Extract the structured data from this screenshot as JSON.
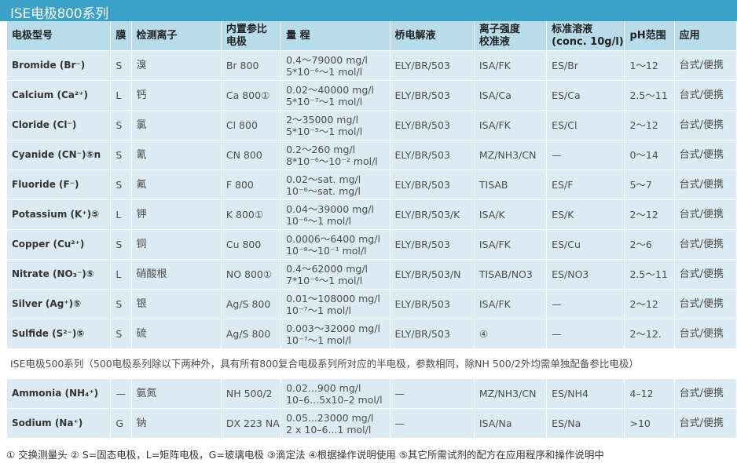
{
  "title": "ISE电极800系列",
  "colors": {
    "title_bg": "#3aa2c8",
    "header_bg": "#b9dceb",
    "row_bg": "#dcebf3"
  },
  "headers": [
    "电极型号",
    "膜",
    "检测离子",
    "内置参比\n电极",
    "量 程",
    "桥电解液",
    "离子强度\n校准液",
    "标准溶液\n(conc. 10g/l)",
    "pH范围",
    "应用"
  ],
  "rows": [
    [
      "Bromide (Br⁻)",
      "S",
      "溴",
      "Br 800",
      "0.4～79000 mg/l",
      "5*10⁻⁶～1 mol/l",
      "ELY/BR/503",
      "ISA/FK",
      "ES/Br",
      "1～12",
      "台式/便携"
    ],
    [
      "Calcium (Ca²⁺)",
      "L",
      "钙",
      "Ca 800①",
      "0.02～40000 mg/l",
      "5*10⁻⁷～1 mol/l",
      "ELY/BR/503",
      "ISA/Ca",
      "ES/Ca",
      "2.5～11",
      "台式/便携"
    ],
    [
      "Cloride (Cl⁻)",
      "S",
      "氯",
      "Cl 800",
      "2～35000 mg/l",
      "5*10⁻⁵～1 mol/l",
      "ELY/BR/503",
      "ISA/FK",
      "ES/Cl",
      "2～12",
      "台式/便携"
    ],
    [
      "Cyanide (CN⁻)⑤n",
      "S",
      "氰",
      "CN 800",
      "0.2～260 mg/l",
      "8*10⁻⁶～10⁻² mol/l",
      "ELY/BR/503",
      "MZ/NH3/CN",
      "—",
      "0～14",
      "台式/便携"
    ],
    [
      "Fluoride (F⁻)",
      "S",
      "氟",
      "F 800",
      "0.02～sat. mg/l",
      "10⁻⁶～sat. mg/l",
      "ELY/BR/503",
      "TISAB",
      "ES/F",
      "5～7",
      "台式/便携"
    ],
    [
      "Potassium (K⁺)⑤",
      "L",
      "钾",
      "K 800①",
      "0.04～39000 mg/l",
      "10⁻⁶～1 mol/l",
      "ELY/BR/503/K",
      "ISA/K",
      "ES/K",
      "2～12",
      "台式/便携"
    ],
    [
      "Copper (Cu²⁺)",
      "S",
      "铜",
      "Cu 800",
      "0.0006～6400 mg/l",
      "10⁻⁸～10⁻¹ mol/l",
      "ELY/BR/503",
      "ISA/FK",
      "ES/Cu",
      "2～6",
      "台式/便携"
    ],
    [
      "Nitrate (NO₃⁻)⑤",
      "L",
      "硝酸根",
      "NO 800①",
      "0.4～62000 mg/l",
      "7*10⁻⁶～1 mol/l",
      "ELY/BR/503/N",
      "TISAB/NO3",
      "ES/NO3",
      "2.5～11",
      "台式/便携"
    ],
    [
      "Silver (Ag⁺)⑤",
      "S",
      "银",
      "Ag/S 800",
      "0.01～108000 mg/l",
      "10⁻⁷～1 mol/l",
      "ELY/BR/503",
      "ISA/FK",
      "—",
      "2～12",
      "台式/便携"
    ],
    [
      "Sulfide (S²⁻)⑤",
      "S",
      "硫",
      "Ag/S 800",
      "0.003～32000 mg/l",
      "10⁻⁷～1 mol/l",
      "ELY/BR/503",
      "④",
      "—",
      "2～12.",
      "台式/便携"
    ]
  ],
  "note_row": "ISE电极500系列（500电极系列除以下两种外，具有所有800复合电极系列所对应的半电极，参数相同，除NH 500/2外均需单独配备参比电极）",
  "rows500": [
    [
      "Ammonia (NH₄⁺)",
      "—",
      "氨氮",
      "NH 500/2",
      "0.02...900 mg/l",
      "10–6...5x10–2 mol/l",
      "—",
      "MZ/NH3/CN",
      "ES/NH4",
      "4–12",
      "台式/便携"
    ],
    [
      "Sodium (Na⁺)",
      "G",
      "钠",
      "DX 223 NA",
      "0.05...23000 mg/l",
      "2 x 10–6...1 mol/l",
      "—",
      "ISA/Na",
      "ES/Na",
      ">10",
      "台式/便携"
    ]
  ],
  "footnote": "① 交换测量头   ② S=固态电极，L=矩阵电极，G=玻璃电极   ③滴定法   ④根据操作说明使用   ⑤其它所需试剂的配方在应用程序和操作说明中"
}
